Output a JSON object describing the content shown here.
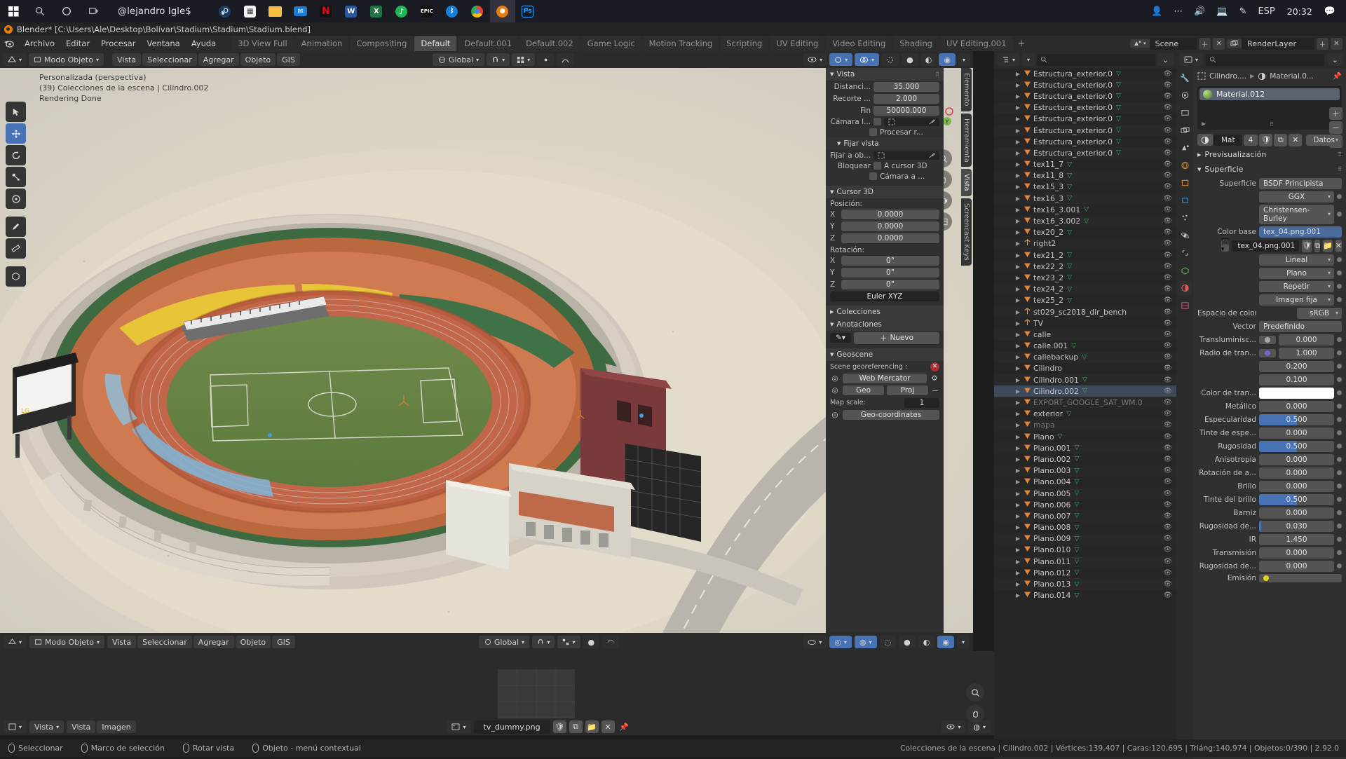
{
  "taskbar": {
    "user": "@lejandro Igle$",
    "apps": [
      "steam",
      "store",
      "explorer",
      "mail",
      "netflix",
      "word",
      "excel",
      "spotify",
      "epic",
      "battlenet",
      "chrome",
      "blender",
      "photoshop"
    ],
    "language": "ESP",
    "clock": "20:32",
    "tray_icons": [
      "people-icon",
      "overflow-icon",
      "volume-icon",
      "network-icon",
      "pen-icon"
    ]
  },
  "window": {
    "title": "Blender* [C:\\Users\\Ale\\Desktop\\Bolívar\\Stadium\\Stadium\\Stadium.blend]"
  },
  "topbar": {
    "menus": [
      "Archivo",
      "Editar",
      "Procesar",
      "Ventana",
      "Ayuda"
    ],
    "workspaces": [
      "3D View Full",
      "Animation",
      "Compositing",
      "Default",
      "Default.001",
      "Default.002",
      "Game Logic",
      "Motion Tracking",
      "Scripting",
      "UV Editing",
      "Video Editing",
      "Shading",
      "UV Editing.001"
    ],
    "active_workspace": "Default",
    "add_workspace": "+",
    "scene": "Scene",
    "view_layer": "RenderLayer"
  },
  "viewport": {
    "overlay_line1": "Personalizada (perspectiva)",
    "overlay_line2": "(39) Colecciones de la escena | Cilindro.002",
    "overlay_line3": "Rendering Done",
    "header": {
      "editor_type": "3d-viewport-icon",
      "mode": "Modo Objeto",
      "menus": [
        "Vista",
        "Seleccionar",
        "Agregar",
        "Objeto",
        "GIS"
      ],
      "transform_orientation": "Global",
      "snap": "magnet-icon",
      "proportional": "proportional-icon"
    },
    "gizmo_axes": [
      "X",
      "Y",
      "Z"
    ],
    "toolbar_tools": [
      "cursor-tool",
      "move-tool",
      "rotate-tool",
      "scale-tool",
      "transform-tool",
      "annotate-tool",
      "measure-tool",
      "add-cube-tool"
    ]
  },
  "npanel": {
    "tabs": [
      "Elemento",
      "Herramienta",
      "Vista",
      "Screencast Keys"
    ],
    "active_tab": "Vista",
    "view": {
      "title": "Vista",
      "rows": [
        {
          "label": "Distanci...",
          "value": "35.000"
        },
        {
          "label": "Recorte ...",
          "value": "2.000"
        },
        {
          "label": "Fin",
          "value": "50000.000"
        }
      ],
      "camera_label": "Cámara l...",
      "render_region_label": "Procesar r...",
      "lock_title": "Fijar vista",
      "lock_to_object_label": "Fijar a ob...",
      "lock_label": "Bloquear",
      "lock_cursor_label": "A cursor 3D",
      "lock_camera_label": "Cámara a ..."
    },
    "cursor": {
      "title": "Cursor 3D",
      "position_label": "Posición:",
      "position": [
        {
          "label": "X",
          "value": "0.0000"
        },
        {
          "label": "Y",
          "value": "0.0000"
        },
        {
          "label": "Z",
          "value": "0.0000"
        }
      ],
      "rotation_label": "Rotación:",
      "rotation": [
        {
          "label": "X",
          "value": "0°"
        },
        {
          "label": "Y",
          "value": "0°"
        },
        {
          "label": "Z",
          "value": "0°"
        }
      ],
      "euler": "Euler XYZ"
    },
    "collections_title": "Colecciones",
    "annotations": {
      "title": "Anotaciones",
      "new_button": "Nuevo"
    },
    "geoscene": {
      "title": "Geoscene",
      "georef_label": "Scene georeferencing :",
      "crs": "Web Mercator",
      "geo_button": "Geo",
      "proj_button": "Proj",
      "map_scale_label": "Map scale:",
      "map_scale_value": "1",
      "geo_coords_button": "Geo-coordinates"
    }
  },
  "outliner": {
    "search_placeholder": "",
    "rows": [
      {
        "name": "Estructura_exterior.0",
        "type": "mesh",
        "mesh": true
      },
      {
        "name": "Estructura_exterior.0",
        "type": "mesh",
        "mesh": true
      },
      {
        "name": "Estructura_exterior.0",
        "type": "mesh",
        "mesh": true
      },
      {
        "name": "Estructura_exterior.0",
        "type": "mesh",
        "mesh": true
      },
      {
        "name": "Estructura_exterior.0",
        "type": "mesh",
        "mesh": true
      },
      {
        "name": "Estructura_exterior.0",
        "type": "mesh",
        "mesh": true
      },
      {
        "name": "Estructura_exterior.0",
        "type": "mesh",
        "mesh": true
      },
      {
        "name": "Estructura_exterior.0",
        "type": "mesh",
        "mesh": true
      },
      {
        "name": "tex11_7",
        "type": "mesh",
        "mesh": true
      },
      {
        "name": "tex11_8",
        "type": "mesh",
        "mesh": true
      },
      {
        "name": "tex15_3",
        "type": "mesh",
        "mesh": true
      },
      {
        "name": "tex16_3",
        "type": "mesh",
        "mesh": true
      },
      {
        "name": "tex16_3.001",
        "type": "mesh",
        "mesh": true
      },
      {
        "name": "tex16_3.002",
        "type": "mesh",
        "mesh": true
      },
      {
        "name": "tex20_2",
        "type": "mesh",
        "mesh": true
      },
      {
        "name": "right2",
        "type": "empty",
        "indent": 0
      },
      {
        "name": "tex21_2",
        "type": "mesh",
        "mesh": true
      },
      {
        "name": "tex22_2",
        "type": "mesh",
        "mesh": true
      },
      {
        "name": "tex23_2",
        "type": "mesh",
        "mesh": true
      },
      {
        "name": "tex24_2",
        "type": "mesh",
        "mesh": true
      },
      {
        "name": "tex25_2",
        "type": "mesh",
        "mesh": true
      },
      {
        "name": "st029_sc2018_dir_bench",
        "type": "empty"
      },
      {
        "name": "TV",
        "type": "empty",
        "extra": true
      },
      {
        "name": "calle",
        "type": "mesh"
      },
      {
        "name": "calle.001",
        "type": "mesh",
        "mesh": true
      },
      {
        "name": "callebackup",
        "type": "mesh",
        "mesh": true
      },
      {
        "name": "Cilindro",
        "type": "mesh"
      },
      {
        "name": "Cilindro.001",
        "type": "mesh",
        "mesh": true
      },
      {
        "name": "Cilindro.002",
        "type": "mesh",
        "mesh": true,
        "selected": true
      },
      {
        "name": "EXPORT_GOOGLE_SAT_WM.0",
        "type": "mesh",
        "dim": true
      },
      {
        "name": "exterior",
        "type": "mesh",
        "mesh": true
      },
      {
        "name": "mapa",
        "type": "mesh",
        "dim": true
      },
      {
        "name": "Plano",
        "type": "mesh",
        "mesh": true
      },
      {
        "name": "Plano.001",
        "type": "mesh",
        "mesh": true
      },
      {
        "name": "Plano.002",
        "type": "mesh",
        "mesh": true
      },
      {
        "name": "Plano.003",
        "type": "mesh",
        "mesh": true
      },
      {
        "name": "Plano.004",
        "type": "mesh",
        "mesh": true
      },
      {
        "name": "Plano.005",
        "type": "mesh",
        "mesh": true
      },
      {
        "name": "Plano.006",
        "type": "mesh",
        "mesh": true
      },
      {
        "name": "Plano.007",
        "type": "mesh",
        "mesh": true
      },
      {
        "name": "Plano.008",
        "type": "mesh",
        "mesh": true
      },
      {
        "name": "Plano.009",
        "type": "mesh",
        "mesh": true
      },
      {
        "name": "Plano.010",
        "type": "mesh",
        "mesh": true
      },
      {
        "name": "Plano.011",
        "type": "mesh",
        "mesh": true
      },
      {
        "name": "Plano.012",
        "type": "mesh",
        "mesh": true
      },
      {
        "name": "Plano.013",
        "type": "mesh",
        "mesh": true
      },
      {
        "name": "Plano.014",
        "type": "mesh",
        "mesh": true
      }
    ]
  },
  "properties": {
    "search_placeholder": "",
    "breadcrumb": {
      "object": "Cilindro....",
      "material": "Material.0..."
    },
    "material_slot": "Material.012",
    "mat_row": {
      "new_label": "Mat",
      "users": "4",
      "data_label": "Datos"
    },
    "preview_title": "Previsualización",
    "surface_title": "Superficie",
    "rows": [
      {
        "label": "Superficie",
        "value": "BSDF Principista",
        "kind": "node",
        "socket": "#8bc34a"
      },
      {
        "label": "",
        "value": "GGX",
        "kind": "menu"
      },
      {
        "label": "",
        "value": "Christensen-Burley",
        "kind": "menu"
      },
      {
        "label": "Color base",
        "value": "tex_04.png.001",
        "kind": "linked",
        "socket": "#d8d818"
      },
      {
        "label": "",
        "value": "tex_04.png.001",
        "kind": "imagefield"
      },
      {
        "label": "",
        "value": "Lineal",
        "kind": "menu"
      },
      {
        "label": "",
        "value": "Plano",
        "kind": "menu"
      },
      {
        "label": "",
        "value": "Repetir",
        "kind": "menu"
      },
      {
        "label": "",
        "value": "Imagen fija",
        "kind": "menu"
      },
      {
        "label": "Espacio de color",
        "value": "sRGB",
        "kind": "menu-small"
      },
      {
        "label": "Vector",
        "value": "Predefinido",
        "kind": "node",
        "socket": "#6e66c8"
      },
      {
        "label": "Transluminisc...",
        "value": "0.000",
        "kind": "value",
        "socket": "#a8a8a8"
      },
      {
        "label": "Radio de tran...",
        "value": "1.000",
        "kind": "value",
        "socket": "#6e66c8"
      },
      {
        "label": "",
        "value": "0.200",
        "kind": "value"
      },
      {
        "label": "",
        "value": "0.100",
        "kind": "value"
      },
      {
        "label": "Color de tran...",
        "value": "",
        "kind": "color",
        "color": "#ffffff"
      },
      {
        "label": "Metálico",
        "value": "0.000",
        "kind": "slider",
        "pct": 0
      },
      {
        "label": "Especularidad",
        "value": "0.500",
        "kind": "slider",
        "pct": 50
      },
      {
        "label": "Tinte de espe...",
        "value": "0.000",
        "kind": "slider",
        "pct": 0
      },
      {
        "label": "Rugosidad",
        "value": "0.500",
        "kind": "slider",
        "pct": 50
      },
      {
        "label": "Anisotropía",
        "value": "0.000",
        "kind": "slider",
        "pct": 0
      },
      {
        "label": "Rotación de a...",
        "value": "0.000",
        "kind": "slider",
        "pct": 0
      },
      {
        "label": "Brillo",
        "value": "0.000",
        "kind": "slider",
        "pct": 0
      },
      {
        "label": "Tinte del brillo",
        "value": "0.500",
        "kind": "slider",
        "pct": 50
      },
      {
        "label": "Barniz",
        "value": "0.000",
        "kind": "slider",
        "pct": 0
      },
      {
        "label": "Rugosidad de...",
        "value": "0.030",
        "kind": "slider",
        "pct": 3
      },
      {
        "label": "IR",
        "value": "1.450",
        "kind": "value"
      },
      {
        "label": "Transmisión",
        "value": "0.000",
        "kind": "slider",
        "pct": 0
      },
      {
        "label": "Rugosidad de...",
        "value": "0.000",
        "kind": "slider",
        "pct": 0
      },
      {
        "label": "Emisión",
        "value": "",
        "kind": "emission",
        "socket": "#d8d818"
      }
    ]
  },
  "image_editor": {
    "menus": [
      "Vista",
      "Imagen"
    ],
    "editor_label": "Vista",
    "image_name": "tv_dummy.png"
  },
  "statusbar": {
    "items": [
      {
        "icon": "mouse-left-icon",
        "label": "Seleccionar"
      },
      {
        "icon": "mouse-drag-icon",
        "label": "Marco de selección"
      },
      {
        "icon": "mouse-middle-icon",
        "label": "Rotar vista"
      },
      {
        "icon": "mouse-right-icon",
        "label": "Objeto - menú contextual"
      }
    ],
    "scene_stats": "Colecciones de la escena | Cilindro.002 | Vértices:139,407 | Caras:120,695 | Triáng:140,974 | Objetos:0/390 | 2.92.0"
  }
}
